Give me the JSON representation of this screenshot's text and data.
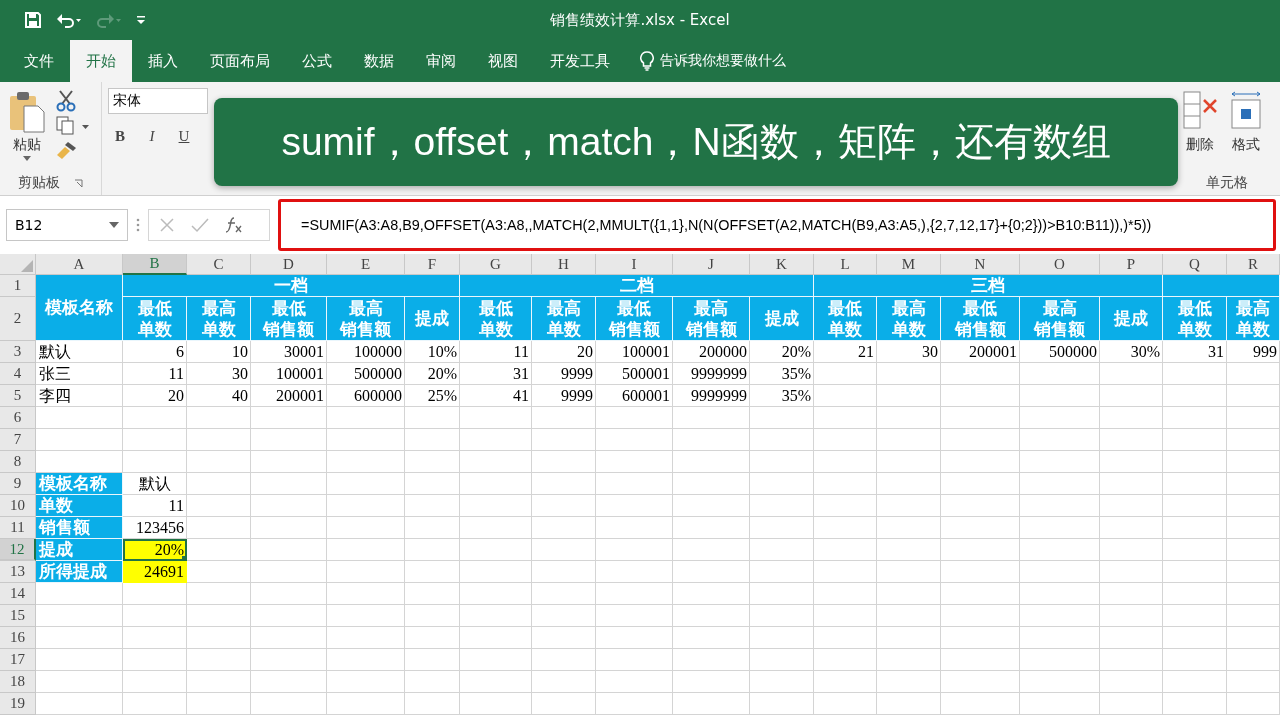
{
  "window": {
    "title": "销售绩效计算.xlsx  -  Excel"
  },
  "tabs": [
    {
      "label": "文件",
      "selected": false
    },
    {
      "label": "开始",
      "selected": true
    },
    {
      "label": "插入",
      "selected": false
    },
    {
      "label": "页面布局",
      "selected": false
    },
    {
      "label": "公式",
      "selected": false
    },
    {
      "label": "数据",
      "selected": false
    },
    {
      "label": "审阅",
      "selected": false
    },
    {
      "label": "视图",
      "selected": false
    },
    {
      "label": "开发工具",
      "selected": false
    }
  ],
  "tell_me": {
    "placeholder": "告诉我你想要做什么"
  },
  "ribbon": {
    "paste": "粘贴",
    "clipboard_group": "剪贴板",
    "font": "宋体",
    "bold": "B",
    "italic": "I",
    "underline": "U",
    "delete": "删除",
    "format": "格式",
    "cells_group": "单元格"
  },
  "banner": {
    "text": "sumif，offset，match，N函数，矩阵，还有数组"
  },
  "formula_bar": {
    "name_box": "B12",
    "formula": "=SUMIF(A3:A8,B9,OFFSET(A3:A8,,MATCH(2,MMULT({1,1},N(N(OFFSET(A2,MATCH(B9,A3:A5,),{2,7,12,17}+{0;2}))>B10:B11)),)*5))"
  },
  "sheet": {
    "columns": [
      {
        "label": "A",
        "selected": false
      },
      {
        "label": "B",
        "selected": true
      },
      {
        "label": "C",
        "selected": false
      },
      {
        "label": "D",
        "selected": false
      },
      {
        "label": "E",
        "selected": false
      },
      {
        "label": "F",
        "selected": false
      },
      {
        "label": "G",
        "selected": false
      },
      {
        "label": "H",
        "selected": false
      },
      {
        "label": "I",
        "selected": false
      },
      {
        "label": "J",
        "selected": false
      },
      {
        "label": "K",
        "selected": false
      },
      {
        "label": "L",
        "selected": false
      },
      {
        "label": "M",
        "selected": false
      },
      {
        "label": "N",
        "selected": false
      },
      {
        "label": "O",
        "selected": false
      },
      {
        "label": "P",
        "selected": false
      },
      {
        "label": "Q",
        "selected": false
      },
      {
        "label": "R",
        "selected": false
      }
    ],
    "row_numbers": [
      {
        "label": "1",
        "selected": false
      },
      {
        "label": "2",
        "selected": false
      },
      {
        "label": "3",
        "selected": false
      },
      {
        "label": "4",
        "selected": false
      },
      {
        "label": "5",
        "selected": false
      },
      {
        "label": "6",
        "selected": false
      },
      {
        "label": "7",
        "selected": false
      },
      {
        "label": "8",
        "selected": false
      },
      {
        "label": "9",
        "selected": false
      },
      {
        "label": "10",
        "selected": false
      },
      {
        "label": "11",
        "selected": false
      },
      {
        "label": "12",
        "selected": true
      },
      {
        "label": "13",
        "selected": false
      },
      {
        "label": "14",
        "selected": false
      },
      {
        "label": "15",
        "selected": false
      },
      {
        "label": "16",
        "selected": false
      },
      {
        "label": "17",
        "selected": false
      },
      {
        "label": "18",
        "selected": false
      },
      {
        "label": "19",
        "selected": false
      }
    ],
    "name_header": "模板名称",
    "tiers": [
      {
        "label": "一档",
        "fields": [
          "最低单数",
          "最高单数",
          "最低销售额",
          "最高销售额",
          "提成"
        ]
      },
      {
        "label": "二档",
        "fields": [
          "最低单数",
          "最高单数",
          "最低销售额",
          "最高销售额",
          "提成"
        ]
      },
      {
        "label": "三档",
        "fields": [
          "最低单数",
          "最高单数",
          "最低销售额",
          "最高销售额",
          "提成"
        ]
      },
      {
        "fields": [
          "最低单数",
          "最高单数"
        ]
      }
    ],
    "rows": [
      {
        "name": "默认",
        "values": [
          "6",
          "10",
          "30001",
          "100000",
          "10%",
          "11",
          "20",
          "100001",
          "200000",
          "20%",
          "21",
          "30",
          "200001",
          "500000",
          "30%",
          "31",
          "999"
        ]
      },
      {
        "name": "张三",
        "values": [
          "11",
          "30",
          "100001",
          "500000",
          "20%",
          "31",
          "9999",
          "500001",
          "9999999",
          "35%"
        ]
      },
      {
        "name": "李四",
        "values": [
          "20",
          "40",
          "200001",
          "600000",
          "25%",
          "41",
          "9999",
          "600001",
          "9999999",
          "35%"
        ]
      }
    ],
    "lookup": [
      {
        "label": "模板名称",
        "value": "默认",
        "kind": "text",
        "highlighted": false,
        "selected": false
      },
      {
        "label": "单数",
        "value": "11",
        "kind": "number",
        "highlighted": false,
        "selected": false
      },
      {
        "label": "销售额",
        "value": "123456",
        "kind": "number",
        "highlighted": false,
        "selected": false
      },
      {
        "label": "提成",
        "value": "20%",
        "kind": "number",
        "highlighted": true,
        "selected": true
      },
      {
        "label": "所得提成",
        "value": "24691",
        "kind": "number",
        "highlighted": true,
        "selected": false
      }
    ]
  }
}
